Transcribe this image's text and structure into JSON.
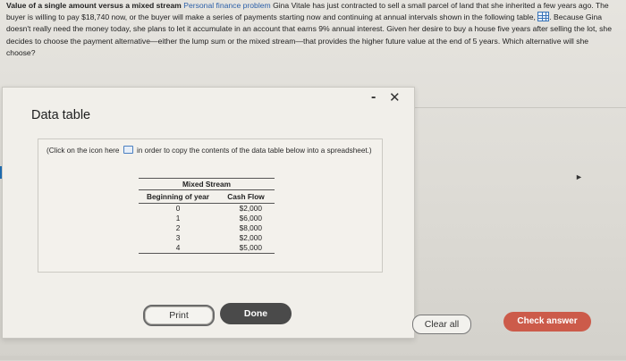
{
  "problem": {
    "lead": "Value of a single amount versus a mixed stream",
    "category": "Personal finance problem",
    "text_part1": "Gina Vitale has just contracted to sell a small parcel of land that she inherited a few years ago. The buyer is willing to pay $18,740 now, or the buyer will make a series of payments starting now and continuing at annual intervals shown in the following table,",
    "text_part2": ". Because Gina doesn't really need the money today, she plans to let it accumulate in an account that earns 9% annual interest. Given her desire to buy a house five years after selling the lot, she decides to choose the payment alternative—either the lump sum or the mixed stream—that provides the higher future value at the end of 5 years. Which alternative will she choose?"
  },
  "dialog": {
    "title": "Data table",
    "minimize": "-",
    "close": "✕",
    "copy_note_part1": "(Click on the icon here",
    "copy_note_part2": "in order to copy the contents of the data table below into a spreadsheet.)",
    "table": {
      "caption": "Mixed Stream",
      "col_year": "Beginning of year",
      "col_cash": "Cash Flow",
      "rows": [
        {
          "year": "0",
          "cash": "$2,000"
        },
        {
          "year": "1",
          "cash": "$6,000"
        },
        {
          "year": "2",
          "cash": "$8,000"
        },
        {
          "year": "3",
          "cash": "$2,000"
        },
        {
          "year": "4",
          "cash": "$5,000"
        }
      ]
    },
    "print_label": "Print",
    "done_label": "Done"
  },
  "actions": {
    "clear_label": "Clear all",
    "check_label": "Check answer"
  },
  "colors": {
    "accent_link": "#2b5fa8",
    "check_button": "#cc5b4a",
    "done_button": "#4a4a4a"
  },
  "icons": [
    "table-icon",
    "copy-icon",
    "minimize-icon",
    "close-icon"
  ]
}
